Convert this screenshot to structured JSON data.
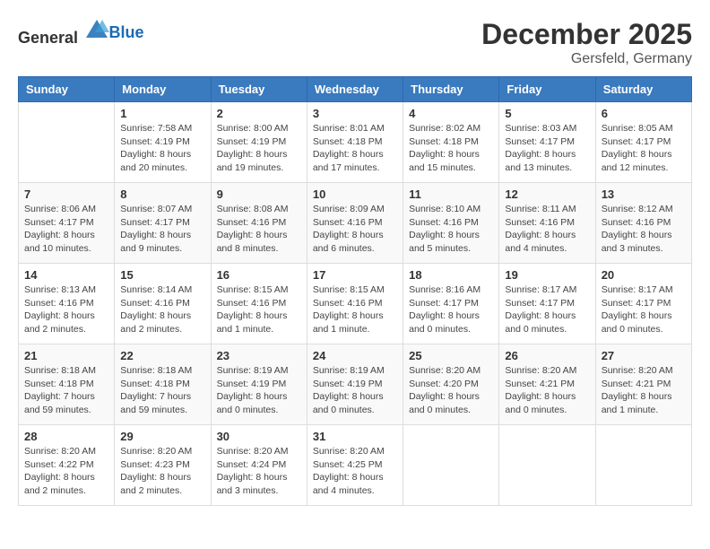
{
  "header": {
    "logo_general": "General",
    "logo_blue": "Blue",
    "month_year": "December 2025",
    "location": "Gersfeld, Germany"
  },
  "weekdays": [
    "Sunday",
    "Monday",
    "Tuesday",
    "Wednesday",
    "Thursday",
    "Friday",
    "Saturday"
  ],
  "weeks": [
    [
      {
        "day": "",
        "sunrise": "",
        "sunset": "",
        "daylight": ""
      },
      {
        "day": "1",
        "sunrise": "Sunrise: 7:58 AM",
        "sunset": "Sunset: 4:19 PM",
        "daylight": "Daylight: 8 hours and 20 minutes."
      },
      {
        "day": "2",
        "sunrise": "Sunrise: 8:00 AM",
        "sunset": "Sunset: 4:19 PM",
        "daylight": "Daylight: 8 hours and 19 minutes."
      },
      {
        "day": "3",
        "sunrise": "Sunrise: 8:01 AM",
        "sunset": "Sunset: 4:18 PM",
        "daylight": "Daylight: 8 hours and 17 minutes."
      },
      {
        "day": "4",
        "sunrise": "Sunrise: 8:02 AM",
        "sunset": "Sunset: 4:18 PM",
        "daylight": "Daylight: 8 hours and 15 minutes."
      },
      {
        "day": "5",
        "sunrise": "Sunrise: 8:03 AM",
        "sunset": "Sunset: 4:17 PM",
        "daylight": "Daylight: 8 hours and 13 minutes."
      },
      {
        "day": "6",
        "sunrise": "Sunrise: 8:05 AM",
        "sunset": "Sunset: 4:17 PM",
        "daylight": "Daylight: 8 hours and 12 minutes."
      }
    ],
    [
      {
        "day": "7",
        "sunrise": "Sunrise: 8:06 AM",
        "sunset": "Sunset: 4:17 PM",
        "daylight": "Daylight: 8 hours and 10 minutes."
      },
      {
        "day": "8",
        "sunrise": "Sunrise: 8:07 AM",
        "sunset": "Sunset: 4:17 PM",
        "daylight": "Daylight: 8 hours and 9 minutes."
      },
      {
        "day": "9",
        "sunrise": "Sunrise: 8:08 AM",
        "sunset": "Sunset: 4:16 PM",
        "daylight": "Daylight: 8 hours and 8 minutes."
      },
      {
        "day": "10",
        "sunrise": "Sunrise: 8:09 AM",
        "sunset": "Sunset: 4:16 PM",
        "daylight": "Daylight: 8 hours and 6 minutes."
      },
      {
        "day": "11",
        "sunrise": "Sunrise: 8:10 AM",
        "sunset": "Sunset: 4:16 PM",
        "daylight": "Daylight: 8 hours and 5 minutes."
      },
      {
        "day": "12",
        "sunrise": "Sunrise: 8:11 AM",
        "sunset": "Sunset: 4:16 PM",
        "daylight": "Daylight: 8 hours and 4 minutes."
      },
      {
        "day": "13",
        "sunrise": "Sunrise: 8:12 AM",
        "sunset": "Sunset: 4:16 PM",
        "daylight": "Daylight: 8 hours and 3 minutes."
      }
    ],
    [
      {
        "day": "14",
        "sunrise": "Sunrise: 8:13 AM",
        "sunset": "Sunset: 4:16 PM",
        "daylight": "Daylight: 8 hours and 2 minutes."
      },
      {
        "day": "15",
        "sunrise": "Sunrise: 8:14 AM",
        "sunset": "Sunset: 4:16 PM",
        "daylight": "Daylight: 8 hours and 2 minutes."
      },
      {
        "day": "16",
        "sunrise": "Sunrise: 8:15 AM",
        "sunset": "Sunset: 4:16 PM",
        "daylight": "Daylight: 8 hours and 1 minute."
      },
      {
        "day": "17",
        "sunrise": "Sunrise: 8:15 AM",
        "sunset": "Sunset: 4:16 PM",
        "daylight": "Daylight: 8 hours and 1 minute."
      },
      {
        "day": "18",
        "sunrise": "Sunrise: 8:16 AM",
        "sunset": "Sunset: 4:17 PM",
        "daylight": "Daylight: 8 hours and 0 minutes."
      },
      {
        "day": "19",
        "sunrise": "Sunrise: 8:17 AM",
        "sunset": "Sunset: 4:17 PM",
        "daylight": "Daylight: 8 hours and 0 minutes."
      },
      {
        "day": "20",
        "sunrise": "Sunrise: 8:17 AM",
        "sunset": "Sunset: 4:17 PM",
        "daylight": "Daylight: 8 hours and 0 minutes."
      }
    ],
    [
      {
        "day": "21",
        "sunrise": "Sunrise: 8:18 AM",
        "sunset": "Sunset: 4:18 PM",
        "daylight": "Daylight: 7 hours and 59 minutes."
      },
      {
        "day": "22",
        "sunrise": "Sunrise: 8:18 AM",
        "sunset": "Sunset: 4:18 PM",
        "daylight": "Daylight: 7 hours and 59 minutes."
      },
      {
        "day": "23",
        "sunrise": "Sunrise: 8:19 AM",
        "sunset": "Sunset: 4:19 PM",
        "daylight": "Daylight: 8 hours and 0 minutes."
      },
      {
        "day": "24",
        "sunrise": "Sunrise: 8:19 AM",
        "sunset": "Sunset: 4:19 PM",
        "daylight": "Daylight: 8 hours and 0 minutes."
      },
      {
        "day": "25",
        "sunrise": "Sunrise: 8:20 AM",
        "sunset": "Sunset: 4:20 PM",
        "daylight": "Daylight: 8 hours and 0 minutes."
      },
      {
        "day": "26",
        "sunrise": "Sunrise: 8:20 AM",
        "sunset": "Sunset: 4:21 PM",
        "daylight": "Daylight: 8 hours and 0 minutes."
      },
      {
        "day": "27",
        "sunrise": "Sunrise: 8:20 AM",
        "sunset": "Sunset: 4:21 PM",
        "daylight": "Daylight: 8 hours and 1 minute."
      }
    ],
    [
      {
        "day": "28",
        "sunrise": "Sunrise: 8:20 AM",
        "sunset": "Sunset: 4:22 PM",
        "daylight": "Daylight: 8 hours and 2 minutes."
      },
      {
        "day": "29",
        "sunrise": "Sunrise: 8:20 AM",
        "sunset": "Sunset: 4:23 PM",
        "daylight": "Daylight: 8 hours and 2 minutes."
      },
      {
        "day": "30",
        "sunrise": "Sunrise: 8:20 AM",
        "sunset": "Sunset: 4:24 PM",
        "daylight": "Daylight: 8 hours and 3 minutes."
      },
      {
        "day": "31",
        "sunrise": "Sunrise: 8:20 AM",
        "sunset": "Sunset: 4:25 PM",
        "daylight": "Daylight: 8 hours and 4 minutes."
      },
      {
        "day": "",
        "sunrise": "",
        "sunset": "",
        "daylight": ""
      },
      {
        "day": "",
        "sunrise": "",
        "sunset": "",
        "daylight": ""
      },
      {
        "day": "",
        "sunrise": "",
        "sunset": "",
        "daylight": ""
      }
    ]
  ]
}
